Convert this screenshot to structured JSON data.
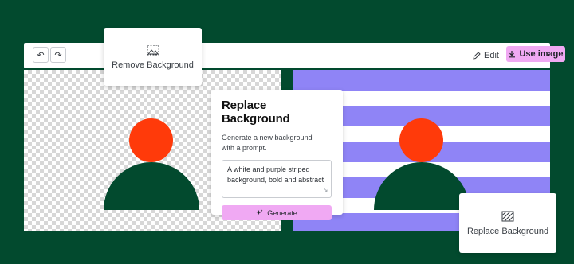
{
  "toolbar": {
    "undo_icon": "undo-icon",
    "redo_icon": "redo-icon",
    "edit_label": "Edit",
    "use_image_label": "Use image"
  },
  "remove_bg_card": {
    "label": "Remove Background",
    "icon": "remove-background-icon"
  },
  "replace_panel": {
    "title": "Replace Background",
    "description": "Generate a new background with a prompt.",
    "prompt_value": "A white and purple striped background, bold and abstract",
    "generate_label": "Generate"
  },
  "replace_bg_card": {
    "label": "Replace Background",
    "icon": "replace-background-icon"
  },
  "colors": {
    "page_background": "#024a2e",
    "accent_pink": "#f0a9f3",
    "stripe_purple": "#8f84f6",
    "figure_head": "#ff3a0a",
    "figure_body": "#024a2e"
  }
}
